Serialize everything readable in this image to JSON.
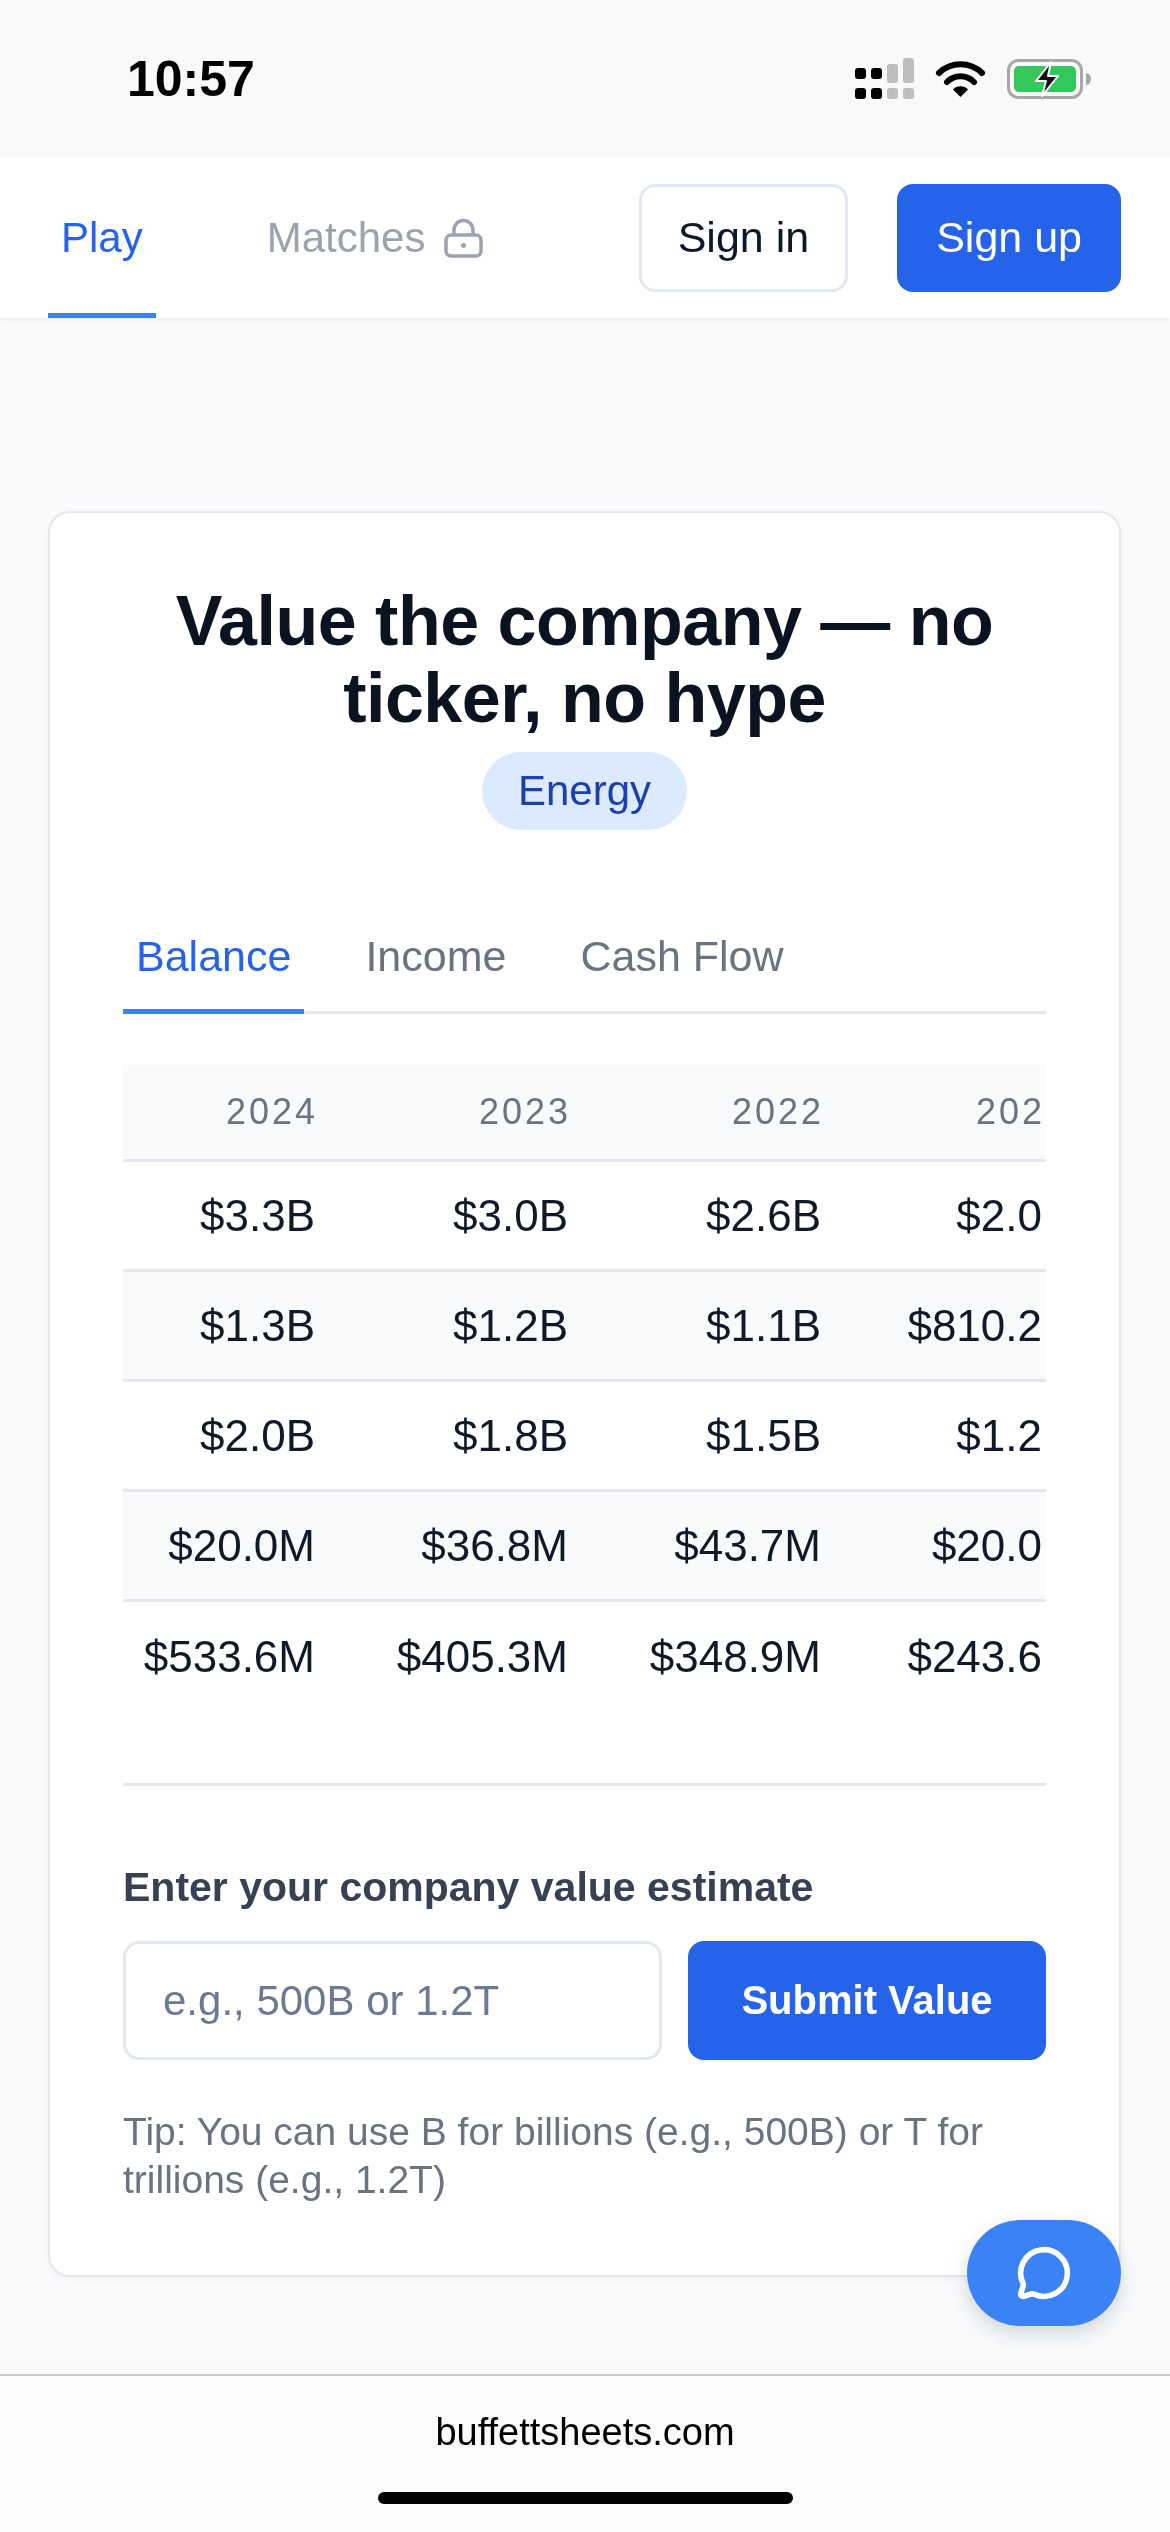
{
  "status_bar": {
    "time": "10:57"
  },
  "nav": {
    "tabs": [
      {
        "label": "Play",
        "selected": true,
        "locked": false
      },
      {
        "label": "Matches",
        "selected": false,
        "locked": true
      }
    ],
    "buttons": [
      {
        "label": "Sign in",
        "kind": "outline"
      },
      {
        "label": "Sign up",
        "kind": "primary"
      }
    ]
  },
  "card": {
    "title": "Value the company — no ticker, no hype",
    "badge": "Energy",
    "tabs": [
      {
        "label": "Balance",
        "selected": true
      },
      {
        "label": "Income",
        "selected": false
      },
      {
        "label": "Cash Flow",
        "selected": false
      }
    ],
    "table": {
      "columns": [
        "2024",
        "2023",
        "2022",
        "202"
      ],
      "rows": [
        [
          "$3.3B",
          "$3.0B",
          "$2.6B",
          "$2.0"
        ],
        [
          "$1.3B",
          "$1.2B",
          "$1.1B",
          "$810.2"
        ],
        [
          "$2.0B",
          "$1.8B",
          "$1.5B",
          "$1.2"
        ],
        [
          "$20.0M",
          "$36.8M",
          "$43.7M",
          "$20.0"
        ],
        [
          "$533.6M",
          "$405.3M",
          "$348.9M",
          "$243.6"
        ]
      ]
    },
    "estimate": {
      "label": "Enter your company value estimate",
      "input": {
        "placeholder": "e.g., 500B or 1.2T"
      },
      "submit": "Submit Value",
      "tip": "Tip: You can use B for billions (e.g., 500B) or T for trillions (e.g., 1.2T)"
    }
  },
  "browser_bar": {
    "url": "buffettsheets.com"
  }
}
